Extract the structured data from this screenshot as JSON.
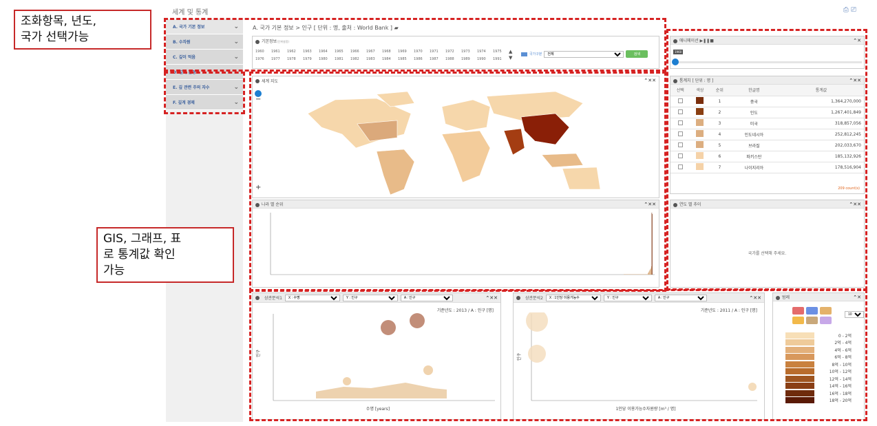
{
  "header": {
    "title": "세계 및 통계"
  },
  "sidebar": {
    "items": [
      {
        "label": "A. 국가 기본 정보"
      },
      {
        "label": "B. 수자원"
      },
      {
        "label": "C. 깊이 먹음"
      },
      {
        "label": "D. 깊게 환경"
      },
      {
        "label": "E. 깊 관련 주의 자수"
      },
      {
        "label": "F. 깊게 경제"
      }
    ]
  },
  "breadcrumb": "A. 국가 기본 정보 > 인구 [ 단위 : 명, 출처 : World Bank ]",
  "basic": {
    "title": "기본정보",
    "hint": "(단위설정)",
    "years_row1": [
      "1960",
      "1961",
      "1962",
      "1963",
      "1964",
      "1965",
      "1966",
      "1967",
      "1968",
      "1969",
      "1970",
      "1971",
      "1972",
      "1973",
      "1974",
      "1975"
    ],
    "years_row2": [
      "1976",
      "1977",
      "1978",
      "1979",
      "1980",
      "1981",
      "1982",
      "1983",
      "1984",
      "1985",
      "1986",
      "1987",
      "1988",
      "1989",
      "1990",
      "1991"
    ],
    "country_label": "국가구분",
    "country_value": "전체",
    "search_button": "검색"
  },
  "animation": {
    "title": "애니메이션",
    "year": "1960"
  },
  "map": {
    "title": "세계 지도"
  },
  "stats": {
    "title": "통계치 [ 단위 : 명 ]",
    "columns": [
      "선택",
      "색상",
      "순위",
      "한글명",
      "통계값"
    ],
    "rows": [
      {
        "rank": "1",
        "name": "중국",
        "value": "1,364,270,000",
        "color": "#7a2e0c"
      },
      {
        "rank": "2",
        "name": "인도",
        "value": "1,267,401,849",
        "color": "#8a3f12"
      },
      {
        "rank": "3",
        "name": "미국",
        "value": "318,857,056",
        "color": "#dcae80"
      },
      {
        "rank": "4",
        "name": "인도네시아",
        "value": "252,812,245",
        "color": "#dcae80"
      },
      {
        "rank": "5",
        "name": "브라질",
        "value": "202,033,670",
        "color": "#dcae80"
      },
      {
        "rank": "6",
        "name": "파키스탄",
        "value": "185,132,926",
        "color": "#f5d2a8"
      },
      {
        "rank": "7",
        "name": "나이지리아",
        "value": "178,516,904",
        "color": "#f5d2a8"
      }
    ],
    "count": "209 count(s)"
  },
  "rank_panel": {
    "title": "나라 별 순위"
  },
  "trend_panel": {
    "title": "연도 별 추이",
    "empty_text": "국가를 선택해 주세요."
  },
  "corr1": {
    "title": "상관분석1",
    "x_label": "X : 수명",
    "y_label": "Y : 인구",
    "a_label": "A : 인구",
    "caption": "기준년도 : 2013 / A : 인구 [명]",
    "xaxis": "수명 [years]",
    "yaxis": "인구"
  },
  "corr2": {
    "title": "상관분석2",
    "x_label": "X : 1인당 이용가능수",
    "y_label": "Y : 인구",
    "a_label": "A : 인구",
    "caption": "기준년도 : 2011 / A : 인구 [명]",
    "xaxis": "1인당 이용가능수자원량 [m³ / 명]",
    "yaxis": "인구"
  },
  "legend": {
    "title": "범례",
    "count": "10 개",
    "items": [
      "0 - 2억",
      "2억 - 4억",
      "4억 - 6억",
      "6억 - 8억",
      "8억 - 10억",
      "10억 - 12억",
      "12억 - 14억",
      "14억 - 16억",
      "16억 - 18억",
      "18억 - 20억"
    ],
    "colors": [
      "#f7dfb7",
      "#efcb9a",
      "#e3b07a",
      "#d8985c",
      "#c9813f",
      "#b86c2c",
      "#9f5520",
      "#8a3f15",
      "#6f2b0c",
      "#5a1a06"
    ],
    "swatches": [
      "#e46b6b",
      "#6b90e4",
      "#e4b26b",
      "#f2b94a",
      "#c9a87a",
      "#c7a8e8"
    ]
  },
  "callouts": {
    "top": "조화항목, 년도,\n국가 선택가능",
    "mid": "GIS, 그래프, 표\n로 통계값 확인\n가능"
  }
}
